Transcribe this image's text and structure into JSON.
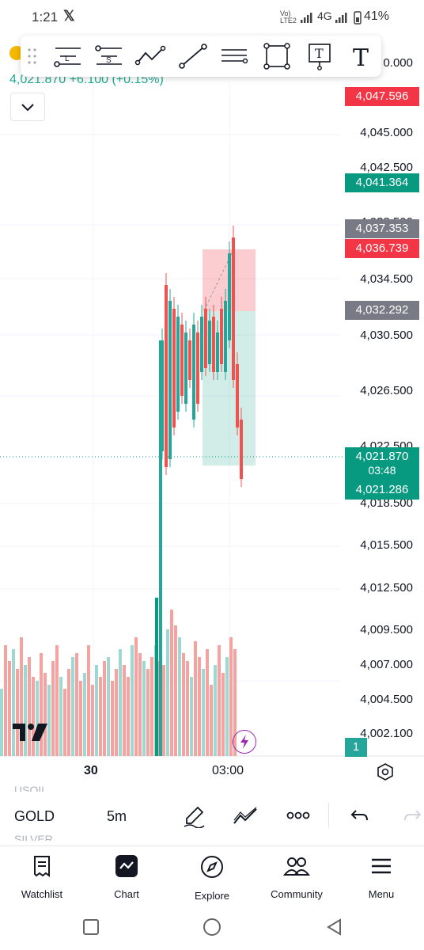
{
  "status": {
    "time": "1:21",
    "network_top": "Vo)",
    "network_mid": "LTE2",
    "network_type": "4G",
    "battery": "41%"
  },
  "toolbar": {
    "tools": [
      "long-position-icon",
      "short-position-icon",
      "path-icon",
      "trend-line-icon",
      "horizontal-lines-icon",
      "rectangle-icon",
      "text-note-icon",
      "text-icon"
    ]
  },
  "ticker": {
    "price_change": "4,021.870  +6.100 (+0.15%)",
    "top_axis_partial": "0.000"
  },
  "axis": {
    "labels": [
      "4,045.000",
      "4,042.500",
      "4,034.500",
      "4,030.500",
      "4,026.500",
      "4,022.500",
      "4,018.500",
      "4,015.500",
      "4,012.500",
      "4,009.500",
      "4,007.000",
      "4,004.500",
      "4,002.100"
    ],
    "partial_label": "4,038.500",
    "time_labels": [
      "30",
      "03:00"
    ]
  },
  "price_tags": {
    "red_top": "4,047.596",
    "green_target": "4,041.364",
    "gray_upper": "4,037.353",
    "red_stop": "4,036.739",
    "gray_lower": "4,032.292",
    "last_price": "4,021.870",
    "countdown": "03:48",
    "bid": "4,021.286",
    "volume_badge": "1"
  },
  "colors": {
    "up": "#26a69a",
    "down": "#ef5350",
    "vol_up": "#9ed8d1",
    "vol_down": "#f5a3a1",
    "accent_green": "#089981",
    "tag_red": "#f23645",
    "tag_gray": "#787b86"
  },
  "controls": {
    "symbol": "GOLD",
    "symbol_above": "USOIL",
    "symbol_below": "SILVER",
    "interval": "5m"
  },
  "nav": {
    "items": [
      {
        "label": "Watchlist",
        "icon": "watchlist-icon"
      },
      {
        "label": "Chart",
        "icon": "chart-icon"
      },
      {
        "label": "Explore",
        "icon": "compass-icon"
      },
      {
        "label": "Community",
        "icon": "community-icon"
      },
      {
        "label": "Menu",
        "icon": "menu-icon"
      }
    ]
  }
}
